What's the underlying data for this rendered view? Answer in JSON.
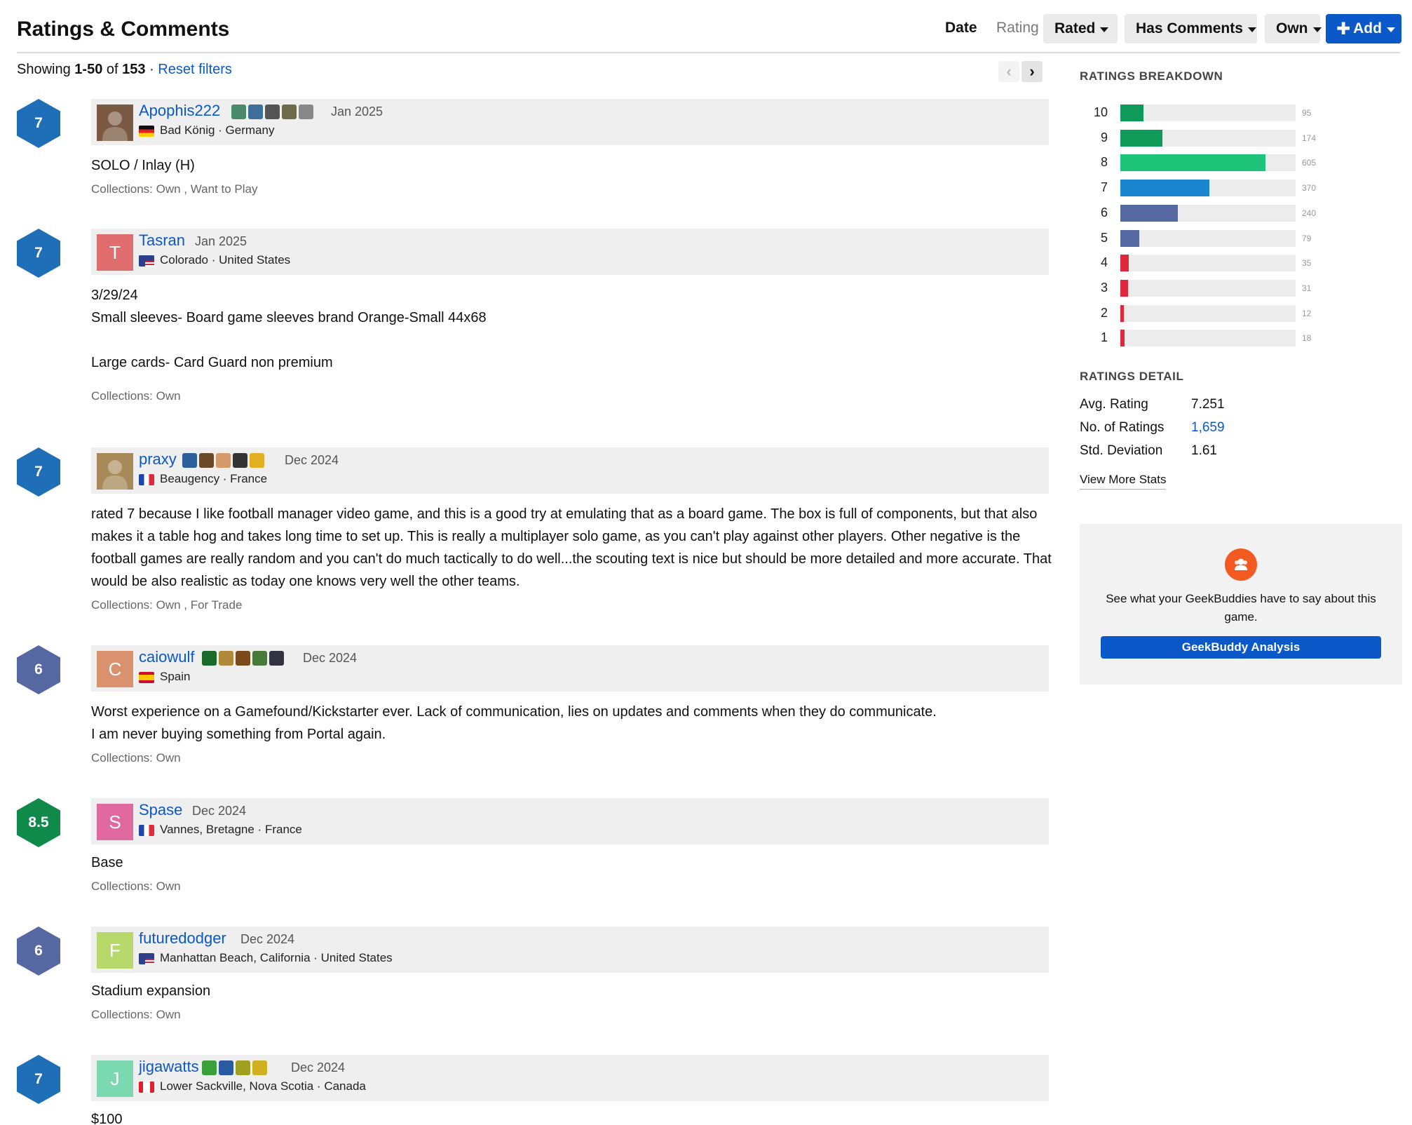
{
  "header": {
    "title": "Ratings & Comments",
    "sort_date": "Date",
    "sort_rating": "Rating",
    "filters": [
      "Rated",
      "Has Comments",
      "Own"
    ],
    "add_label": "Add"
  },
  "showing": {
    "prefix": "Showing",
    "range": "1-50",
    "of": "of",
    "total": "153",
    "sep": "·",
    "reset": "Reset filters"
  },
  "comments": [
    {
      "rating": "7",
      "rating_color": "#1f6fb8",
      "username": "Apophis222",
      "avatar_letter": "",
      "avatar_color": "#7a5a42",
      "date": "Jan 2025",
      "location": "Bad König · Germany",
      "flag": "germany",
      "badges": [
        "#4a8a6a",
        "#3d6f9a",
        "#555555",
        "#6b6b4a",
        "#888888"
      ],
      "text": [
        "SOLO / Inlay (H)"
      ],
      "collections": "Collections: Own , Want to Play"
    },
    {
      "rating": "7",
      "rating_color": "#1f6fb8",
      "username": "Tasran",
      "avatar_letter": "T",
      "avatar_color": "#e06d6d",
      "date": "Jan 2025",
      "location": "Colorado · United States",
      "flag": "usa",
      "badges": [],
      "text": [
        "3/29/24",
        "Small sleeves- Board game sleeves brand Orange-Small 44x68",
        "",
        "Large cards- Card Guard non premium"
      ],
      "collections": "Collections: Own"
    },
    {
      "rating": "7",
      "rating_color": "#1f6fb8",
      "username": "praxy",
      "avatar_letter": "",
      "avatar_color": "#a88a5a",
      "date": "Dec 2024",
      "location": "Beaugency · France",
      "flag": "france",
      "badges": [
        "#2d5f9a",
        "#6a4a2a",
        "#d49a6a",
        "#333333",
        "#e0b020"
      ],
      "text": [
        "rated 7 because I like football manager video game, and this is a good try at emulating that as a board game. The box is full of components, but that also makes it a table hog and takes long time to set up. This is really a multiplayer solo game, as you can't play against other players. Other negative is the football games are really random and you can't do much tactically to do well...the scouting text is nice but should be more detailed and more accurate. That would be also realistic as today one knows very well the other teams."
      ],
      "collections": "Collections: Own , For Trade"
    },
    {
      "rating": "6",
      "rating_color": "#5568a2",
      "username": "caiowulf",
      "avatar_letter": "C",
      "avatar_color": "#d9926d",
      "date": "Dec 2024",
      "location": "Spain",
      "flag": "spain",
      "badges": [
        "#1a6a2a",
        "#b08a3a",
        "#7a4a1a",
        "#4a7a3a",
        "#333344"
      ],
      "text": [
        "Worst experience on a Gamefound/Kickstarter ever. Lack of communication, lies on updates and comments when they do communicate.",
        "I am never buying something from Portal again."
      ],
      "collections": "Collections: Own"
    },
    {
      "rating": "8.5",
      "rating_color": "#0f8a4a",
      "username": "Spase",
      "avatar_letter": "S",
      "avatar_color": "#e06aa0",
      "date": "Dec 2024",
      "location": "Vannes, Bretagne · France",
      "flag": "france",
      "badges": [],
      "text": [
        "Base"
      ],
      "collections": "Collections: Own"
    },
    {
      "rating": "6",
      "rating_color": "#5568a2",
      "username": "futuredodger",
      "avatar_letter": "F",
      "avatar_color": "#b7d86a",
      "date": "Dec 2024",
      "location": "Manhattan Beach, California · United States",
      "flag": "usa",
      "badges": [],
      "text": [
        "Stadium expansion"
      ],
      "collections": "Collections: Own"
    },
    {
      "rating": "7",
      "rating_color": "#1f6fb8",
      "username": "jigawatts",
      "avatar_letter": "J",
      "avatar_color": "#7ad9b0",
      "date": "Dec 2024",
      "location": "Lower Sackville, Nova Scotia · Canada",
      "flag": "canada",
      "badges": [
        "#3aa03a",
        "#2a5aa0",
        "#a0a020",
        "#d0b020"
      ],
      "text": [
        "$100"
      ],
      "collections": ""
    }
  ],
  "sidebar": {
    "breakdown_title": "RATINGS BREAKDOWN",
    "breakdown": [
      {
        "label": "10",
        "count": "95",
        "value": 95,
        "color": "#0f9a5a"
      },
      {
        "label": "9",
        "count": "174",
        "value": 174,
        "color": "#0f9a5a"
      },
      {
        "label": "8",
        "count": "605",
        "value": 605,
        "color": "#1ec47a"
      },
      {
        "label": "7",
        "count": "370",
        "value": 370,
        "color": "#1a86cf"
      },
      {
        "label": "6",
        "count": "240",
        "value": 240,
        "color": "#5568a2"
      },
      {
        "label": "5",
        "count": "79",
        "value": 79,
        "color": "#5568a2"
      },
      {
        "label": "4",
        "count": "35",
        "value": 35,
        "color": "#e0283c"
      },
      {
        "label": "3",
        "count": "31",
        "value": 31,
        "color": "#e0283c"
      },
      {
        "label": "2",
        "count": "12",
        "value": 12,
        "color": "#e0283c"
      },
      {
        "label": "1",
        "count": "18",
        "value": 18,
        "color": "#e0283c"
      }
    ],
    "breakdown_max": 605,
    "detail_title": "RATINGS DETAIL",
    "detail": [
      {
        "label": "Avg. Rating",
        "value": "7.251",
        "link": false
      },
      {
        "label": "No. of Ratings",
        "value": "1,659",
        "link": true
      },
      {
        "label": "Std. Deviation",
        "value": "1.61",
        "link": false
      }
    ],
    "more_stats": "View More Stats",
    "buddy_text": "See what your GeekBuddies have to say about this game.",
    "buddy_button": "GeekBuddy Analysis"
  }
}
